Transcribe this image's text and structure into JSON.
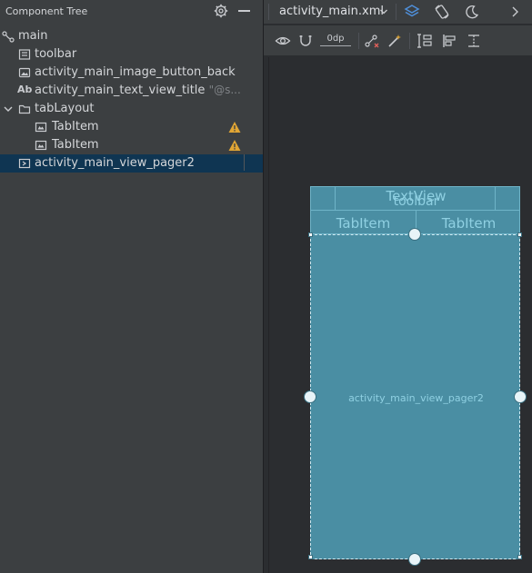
{
  "tree": {
    "title": "Component Tree",
    "items": [
      {
        "label": "main",
        "icon": "constraint-layout-icon",
        "hint": ""
      },
      {
        "label": "toolbar",
        "icon": "toolbar-widget-icon",
        "hint": ""
      },
      {
        "label": "activity_main_image_button_back",
        "icon": "image-button-icon",
        "hint": ""
      },
      {
        "label": "activity_main_text_view_title",
        "icon": "textview-icon",
        "hint": "\"@s..."
      },
      {
        "label": "tabLayout",
        "icon": "folder-icon",
        "hint": ""
      },
      {
        "label": "TabItem",
        "icon": "tab-item-icon",
        "hint": "",
        "warning": true
      },
      {
        "label": "TabItem",
        "icon": "tab-item-icon",
        "hint": "",
        "warning": true
      },
      {
        "label": "activity_main_view_pager2",
        "icon": "view-pager-icon",
        "hint": "",
        "selected": true
      }
    ],
    "textview_icon_glyph": "Ab"
  },
  "toolbar": {
    "file_name": "activity_main.xml",
    "dp_value": "0dp"
  },
  "blueprint": {
    "toolbar_label": "toolbar",
    "textview_label": "TextView",
    "tab1_label": "TabItem",
    "tab2_label": "TabItem",
    "pager_label": "activity_main_view_pager2"
  },
  "colors": {
    "panel_bg": "#3c3f41",
    "selection_bg": "#0f3552",
    "blueprint_fill": "#4a8ea3",
    "blueprint_text": "#8fd0e2",
    "warning": "#e0a534",
    "accent_blue": "#4f8fd9"
  }
}
